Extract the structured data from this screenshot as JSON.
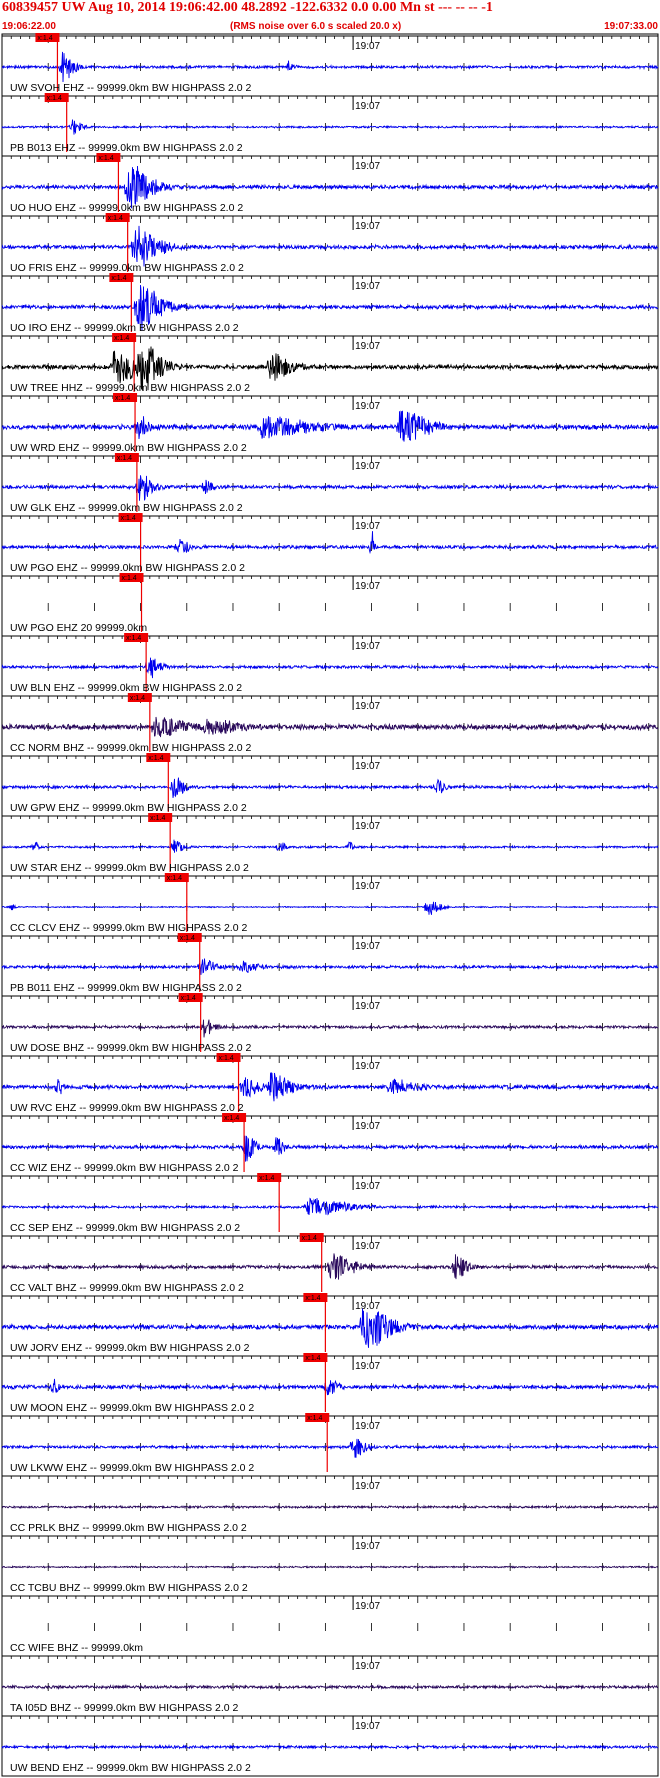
{
  "header": {
    "title": "60839457 UW Aug 10, 2014 19:06:42.00   48.2892 -122.6332  0.0 0.00 Mn st --- -- --   -1",
    "start_time": "19:06:22.00",
    "note": "(RMS noise over 6.0 s scaled 20.0 x)",
    "end_time": "19:07:33.00"
  },
  "colors": {
    "blue": "#0000ee",
    "purple": "#2a0a5c",
    "black": "#000000",
    "pick": "#ee0000"
  },
  "chart_data": {
    "type": "seismogram",
    "x_start": "19:06:22.00",
    "x_end": "19:07:33.00",
    "x_range_seconds": [
      0,
      71
    ],
    "minute_label": "19:07",
    "pick_label": "x:1.4",
    "traces": [
      {
        "label": "UW SVOH EHZ -- 99999.0km BW  HIGHPASS  2.0  2",
        "color": "blue",
        "pick": 6.0,
        "noise": 0.28,
        "bursts": [
          [
            6.5,
            1.4,
            2.8
          ],
          [
            31,
            0.6,
            1.2
          ]
        ]
      },
      {
        "label": "PB B013 EHZ -- 99999.0km BW  HIGHPASS  2.0  2",
        "color": "blue",
        "pick": 7.0,
        "noise": 0.2,
        "bursts": [
          [
            7.6,
            1.2,
            1.4
          ]
        ]
      },
      {
        "label": "UO HUO EHZ -- 99999.0km BW  HIGHPASS  2.0  2",
        "color": "blue",
        "pick": 12.6,
        "noise": 0.4,
        "bursts": [
          [
            13.5,
            3.0,
            4.5
          ]
        ]
      },
      {
        "label": "UO FRIS EHZ -- 99999.0km BW  HIGHPASS  2.0  2",
        "color": "blue",
        "pick": 13.6,
        "noise": 0.4,
        "bursts": [
          [
            14.3,
            3.0,
            4.2
          ]
        ]
      },
      {
        "label": "UO IRO EHZ -- 99999.0km BW  HIGHPASS  2.0  2",
        "color": "blue",
        "pick": 14.0,
        "noise": 0.4,
        "bursts": [
          [
            14.6,
            3.0,
            4.5
          ]
        ]
      },
      {
        "label": "UW TREE HHZ -- 99999.0km BW  HIGHPASS  2.0  2",
        "color": "black",
        "pick": 14.3,
        "noise": 0.45,
        "bursts": [
          [
            12,
            3.5,
            3.0
          ],
          [
            15,
            2.5,
            4.0
          ],
          [
            29,
            2.5,
            2.5
          ]
        ]
      },
      {
        "label": "UW WRD EHZ -- 99999.0km BW  HIGHPASS  2.0  2",
        "color": "blue",
        "pick": 14.4,
        "noise": 0.5,
        "bursts": [
          [
            14.6,
            1.5,
            2.2
          ],
          [
            28,
            6,
            1.8
          ],
          [
            43,
            3.5,
            3.0
          ]
        ]
      },
      {
        "label": "UW GLK EHZ -- 99999.0km BW  HIGHPASS  2.0  2",
        "color": "blue",
        "pick": 14.6,
        "noise": 0.35,
        "bursts": [
          [
            14.8,
            1.6,
            2.8
          ],
          [
            22,
            0.8,
            1.6
          ]
        ]
      },
      {
        "label": "UW PGO EHZ -- 99999.0km BW  HIGHPASS  2.0  2",
        "color": "blue",
        "pick": 15.0,
        "noise": 0.35,
        "bursts": [
          [
            19,
            1.5,
            1.4
          ],
          [
            40,
            0.35,
            3.2
          ]
        ]
      },
      {
        "label": "UW PGO EHZ 20 99999.0km",
        "color": "blue",
        "pick": 15.1,
        "noise": 0,
        "bursts": []
      },
      {
        "label": "UW BLN EHZ -- 99999.0km BW  HIGHPASS  2.0  2",
        "color": "blue",
        "pick": 15.6,
        "noise": 0.3,
        "bursts": [
          [
            15.8,
            1.4,
            2.2
          ]
        ]
      },
      {
        "label": "CC NORM BHZ -- 99999.0km BW  HIGHPASS  2.0  2",
        "color": "purple",
        "pick": 16.0,
        "noise": 0.55,
        "bursts": [
          [
            16.5,
            4,
            1.6
          ],
          [
            22,
            4,
            1.2
          ]
        ]
      },
      {
        "label": "UW GPW EHZ -- 99999.0km BW  HIGHPASS  2.0  2",
        "color": "blue",
        "pick": 18.0,
        "noise": 0.3,
        "bursts": [
          [
            18.5,
            1.4,
            2.0
          ],
          [
            47,
            1.2,
            1.2
          ]
        ]
      },
      {
        "label": "UW STAR EHZ -- 99999.0km BW  HIGHPASS  2.0  2",
        "color": "blue",
        "pick": 18.2,
        "noise": 0.22,
        "bursts": [
          [
            3.5,
            0.4,
            1.6
          ],
          [
            18.6,
            1.0,
            1.4
          ],
          [
            30,
            0.7,
            1.2
          ],
          [
            37.5,
            0.6,
            1.0
          ]
        ]
      },
      {
        "label": "CC CLCV EHZ -- 99999.0km BW  HIGHPASS  2.0  2",
        "color": "blue",
        "pick": 20.0,
        "noise": 0.12,
        "bursts": [
          [
            1,
            0.4,
            0.7
          ],
          [
            46,
            1.5,
            1.8
          ]
        ]
      },
      {
        "label": "PB B011 EHZ -- 99999.0km BW  HIGHPASS  2.0  2",
        "color": "blue",
        "pick": 21.4,
        "noise": 0.3,
        "bursts": [
          [
            21.5,
            2.0,
            1.5
          ],
          [
            26,
            1.8,
            1.1
          ]
        ]
      },
      {
        "label": "UW DOSE BHZ -- 99999.0km BW  HIGHPASS  2.0  2",
        "color": "purple",
        "pick": 21.5,
        "noise": 0.3,
        "bursts": [
          [
            21.8,
            1.2,
            1.8
          ]
        ]
      },
      {
        "label": "UW RVC EHZ -- 99999.0km BW  HIGHPASS  2.0  2",
        "color": "blue",
        "pick": 25.6,
        "noise": 0.4,
        "bursts": [
          [
            6,
            0.6,
            1.6
          ],
          [
            26,
            2,
            2.0
          ],
          [
            29,
            2.5,
            2.5
          ],
          [
            42,
            3,
            1.4
          ]
        ]
      },
      {
        "label": "CC WIZ EHZ -- 99999.0km BW  HIGHPASS  2.0  2",
        "color": "blue",
        "pick": 26.2,
        "noise": 0.35,
        "bursts": [
          [
            26.3,
            1.2,
            2.8
          ],
          [
            29.6,
            1.0,
            1.8
          ]
        ]
      },
      {
        "label": "CC SEP EHZ -- 99999.0km BW  HIGHPASS  2.0  2",
        "color": "blue",
        "pick": 30.0,
        "noise": 0.25,
        "bursts": [
          [
            33,
            5,
            1.6
          ]
        ]
      },
      {
        "label": "CC VALT BHZ -- 99999.0km BW  HIGHPASS  2.0  2",
        "color": "purple",
        "pick": 34.6,
        "noise": 0.35,
        "bursts": [
          [
            35.5,
            3,
            2.4
          ],
          [
            49,
            1.5,
            2.6
          ]
        ]
      },
      {
        "label": "UW JORV EHZ -- 99999.0km BW  HIGHPASS  2.0  2",
        "color": "blue",
        "pick": 35.0,
        "noise": 0.45,
        "bursts": [
          [
            39,
            3.5,
            4.2
          ]
        ]
      },
      {
        "label": "UW MOON EHZ -- 99999.0km BW  HIGHPASS  2.0  2",
        "color": "blue",
        "pick": 35.0,
        "noise": 0.4,
        "bursts": [
          [
            5.5,
            0.7,
            1.4
          ],
          [
            35.2,
            1.2,
            1.8
          ]
        ]
      },
      {
        "label": "UW LKWW EHZ -- 99999.0km BW  HIGHPASS  2.0  2",
        "color": "blue",
        "pick": 35.2,
        "noise": 0.28,
        "bursts": [
          [
            38,
            1.5,
            2.0
          ]
        ]
      },
      {
        "label": "CC PRLK BHZ -- 99999.0km BW  HIGHPASS  2.0  2",
        "color": "purple",
        "pick": null,
        "noise": 0.22,
        "bursts": []
      },
      {
        "label": "CC TCBU BHZ -- 99999.0km BW  HIGHPASS  2.0  2",
        "color": "purple",
        "pick": null,
        "noise": 0.16,
        "bursts": []
      },
      {
        "label": "CC WIFE BHZ -- 99999.0km",
        "color": "purple",
        "pick": null,
        "noise": 0,
        "bursts": []
      },
      {
        "label": "TA I05D BHZ -- 99999.0km BW  HIGHPASS  2.0  2",
        "color": "purple",
        "pick": null,
        "noise": 0.3,
        "bursts": []
      },
      {
        "label": "UW BEND EHZ -- 99999.0km BW  HIGHPASS  2.0  2",
        "color": "blue",
        "pick": null,
        "noise": 0.28,
        "bursts": []
      }
    ]
  }
}
